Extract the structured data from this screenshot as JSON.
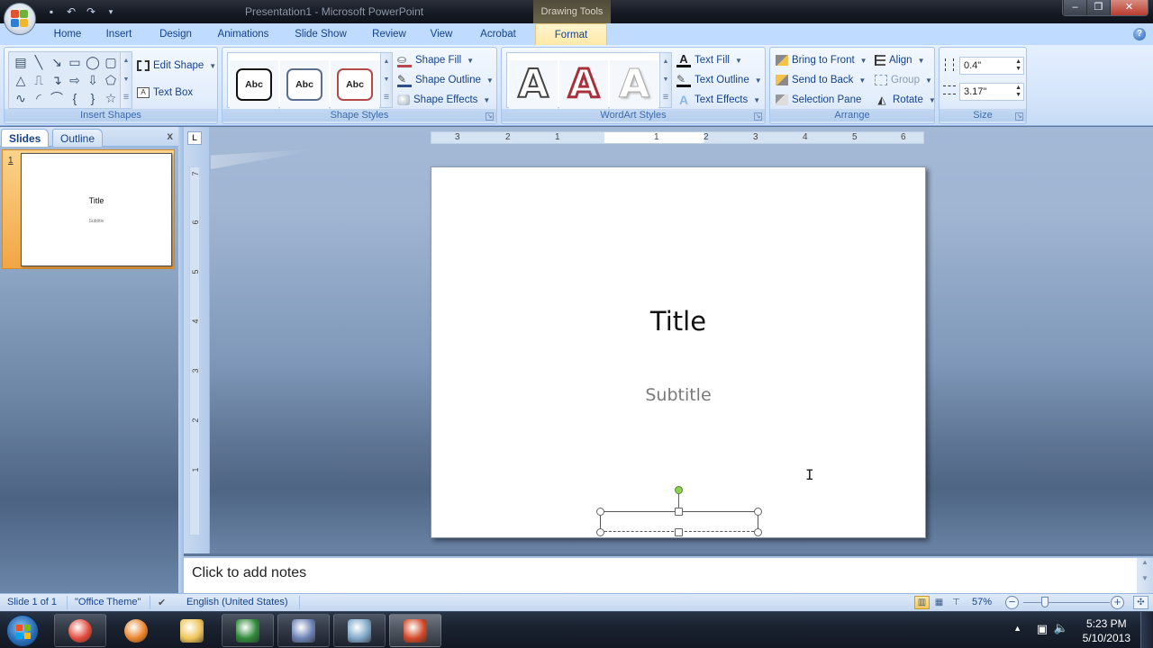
{
  "titlebar": {
    "title": "Presentation1 - Microsoft PowerPoint",
    "contextual_tab_group": "Drawing Tools",
    "quick_access": [
      "save-icon",
      "undo-icon",
      "redo-icon",
      "customize-icon"
    ],
    "window_controls": {
      "minimize": "–",
      "restore": "❐",
      "close": "✕"
    }
  },
  "tabs": [
    {
      "label": "Home",
      "active": false
    },
    {
      "label": "Insert",
      "active": false
    },
    {
      "label": "Design",
      "active": false
    },
    {
      "label": "Animations",
      "active": false
    },
    {
      "label": "Slide Show",
      "active": false
    },
    {
      "label": "Review",
      "active": false
    },
    {
      "label": "View",
      "active": false
    },
    {
      "label": "Acrobat",
      "active": false
    },
    {
      "label": "Format",
      "active": true
    }
  ],
  "help_label": "?",
  "ribbon": {
    "insert_shapes": {
      "label": "Insert Shapes",
      "shapes": [
        "text-box-shape",
        "line",
        "arrow-line",
        "rectangle",
        "oval",
        "rounded-rectangle",
        "triangle",
        "elbow-connector",
        "elbow-arrow-connector",
        "right-arrow",
        "down-arrow",
        "callout",
        "freeform",
        "arc",
        "curve",
        "left-brace",
        "right-brace",
        "star"
      ],
      "shape_glyphs": [
        "▤",
        "╲",
        "↘",
        "▭",
        "◯",
        "▢",
        "△",
        "⎍",
        "↴",
        "⇨",
        "⇩",
        "⬠",
        "∿",
        "◜",
        "⌒",
        "{",
        "}",
        "☆"
      ],
      "edit_shape": "Edit Shape",
      "text_box": "Text Box"
    },
    "shape_styles": {
      "label": "Shape Styles",
      "presets": [
        {
          "text": "Abc",
          "border": "#111111"
        },
        {
          "text": "Abc",
          "border": "#5a6f8e"
        },
        {
          "text": "Abc",
          "border": "#b5494a"
        }
      ],
      "shape_fill": "Shape Fill",
      "shape_outline": "Shape Outline",
      "shape_effects": "Shape Effects"
    },
    "wordart_styles": {
      "label": "WordArt Styles",
      "presets": [
        {
          "text": "A",
          "style": "outline-gray"
        },
        {
          "text": "A",
          "style": "red-outline"
        },
        {
          "text": "A",
          "style": "light-shadow"
        }
      ],
      "text_fill": "Text Fill",
      "text_outline": "Text Outline",
      "text_effects": "Text Effects"
    },
    "arrange": {
      "label": "Arrange",
      "bring_to_front": "Bring to Front",
      "send_to_back": "Send to Back",
      "selection_pane": "Selection Pane",
      "align": "Align",
      "group": "Group",
      "rotate": "Rotate"
    },
    "size": {
      "label": "Size",
      "height": "0.4\"",
      "width": "3.17\""
    }
  },
  "left_pane": {
    "tabs": [
      {
        "label": "Slides",
        "active": true
      },
      {
        "label": "Outline",
        "active": false
      }
    ],
    "close": "x",
    "slides": [
      {
        "number": "1",
        "title": "Title",
        "subtitle": "Subtitle"
      }
    ]
  },
  "rulers": {
    "corner": "L",
    "horizontal_ticks": [
      "3",
      "2",
      "1",
      "1",
      "2",
      "3",
      "4",
      "5",
      "6"
    ],
    "vertical_ticks": [
      "7",
      "6",
      "5",
      "4",
      "3",
      "2",
      "1"
    ]
  },
  "slide": {
    "title": "Title",
    "subtitle": "Subtitle",
    "cursor": "I"
  },
  "notes": {
    "placeholder": "Click to add notes"
  },
  "status_bar": {
    "slide_info": "Slide 1 of 1",
    "theme": "\"Office Theme\"",
    "language": "English (United States)",
    "zoom": "57%",
    "zoom_value_percent": 57,
    "views": [
      "normal-view",
      "slide-sorter-view",
      "slide-show-view"
    ]
  },
  "taskbar": {
    "apps": [
      {
        "name": "chrome",
        "color": "#e04a3a"
      },
      {
        "name": "firefox",
        "color": "#e8832a"
      },
      {
        "name": "windows-explorer",
        "color": "#f0c65a"
      },
      {
        "name": "excel",
        "color": "#2f8a3a"
      },
      {
        "name": "movie-maker",
        "color": "#6d83b5"
      },
      {
        "name": "notepad-app",
        "color": "#7fa8c8"
      },
      {
        "name": "powerpoint",
        "color": "#d24a2a"
      }
    ],
    "tray": {
      "time": "5:23 PM",
      "date": "5/10/2013"
    }
  }
}
